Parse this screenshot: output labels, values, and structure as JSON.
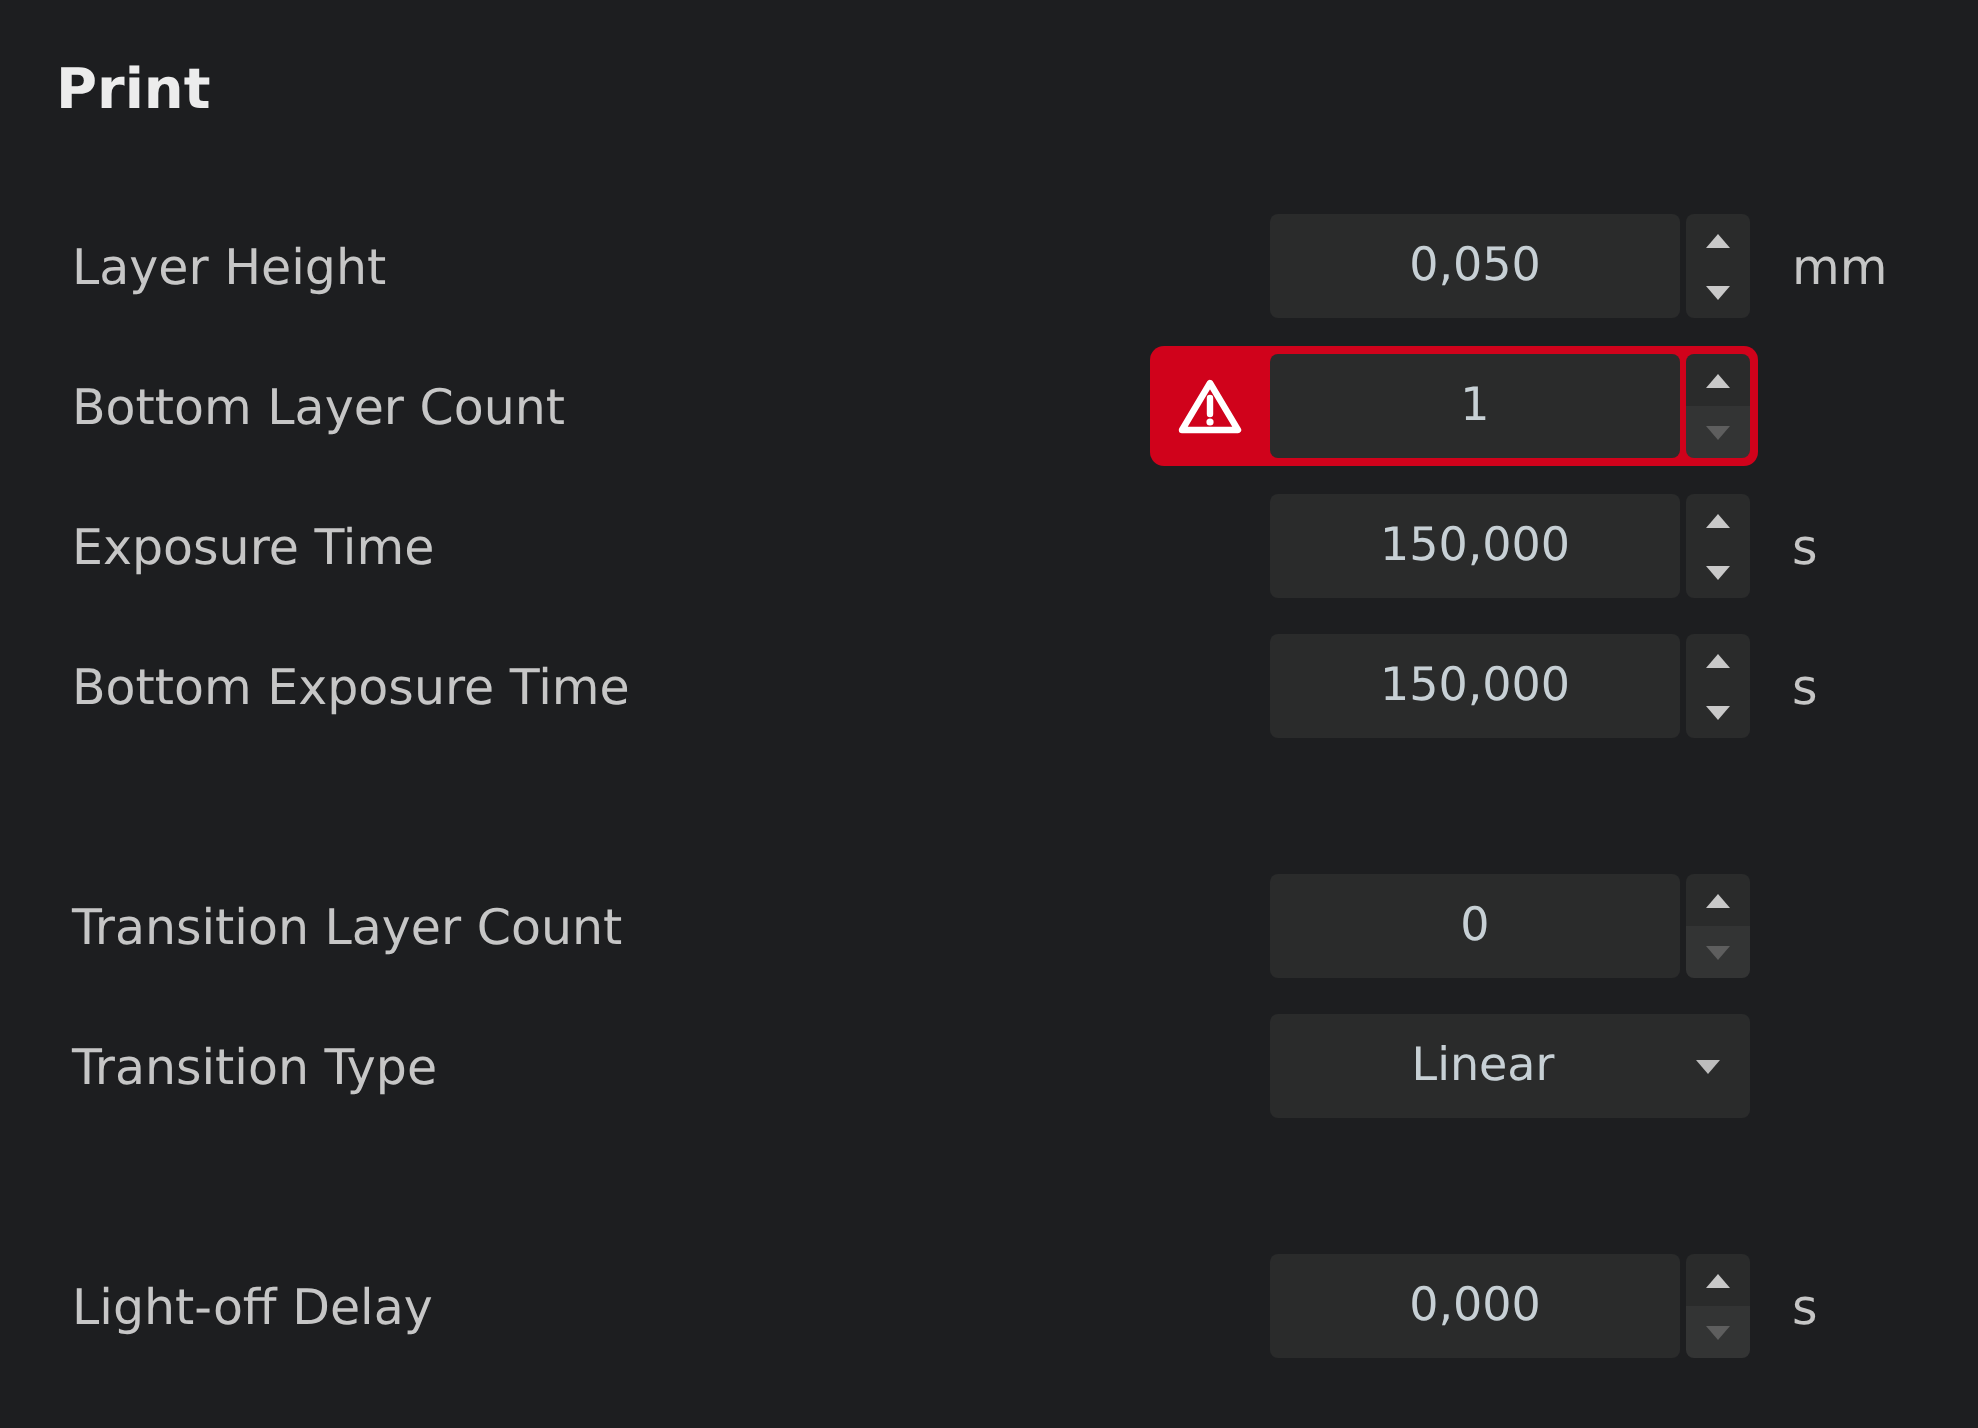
{
  "title": "Print",
  "groups": [
    {
      "rows": [
        {
          "kind": "spin",
          "label": "Layer Height",
          "value": "0,050",
          "unit": "mm",
          "error": false,
          "down_disabled": false
        },
        {
          "kind": "spin",
          "label": "Bottom Layer Count",
          "value": "1",
          "error": true,
          "down_disabled": true
        },
        {
          "kind": "spin",
          "label": "Exposure Time",
          "value": "150,000",
          "unit": "s",
          "error": false,
          "down_disabled": false
        },
        {
          "kind": "spin",
          "label": "Bottom Exposure Time",
          "value": "150,000",
          "unit": "s",
          "error": false,
          "down_disabled": false
        }
      ]
    },
    {
      "rows": [
        {
          "kind": "spin",
          "label": "Transition Layer Count",
          "value": "0",
          "error": false,
          "down_disabled": true
        },
        {
          "kind": "select",
          "label": "Transition Type",
          "value": "Linear"
        }
      ]
    },
    {
      "rows": [
        {
          "kind": "spin",
          "label": "Light-off Delay",
          "value": "0,000",
          "unit": "s",
          "error": false,
          "down_disabled": true
        }
      ]
    }
  ]
}
